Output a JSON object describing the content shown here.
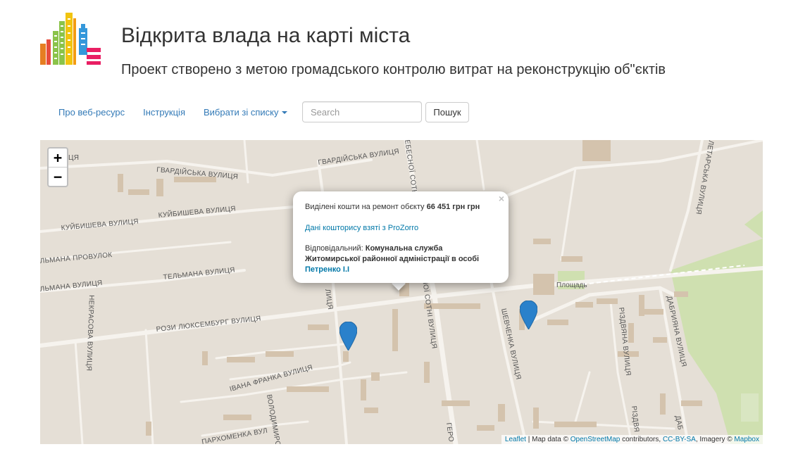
{
  "header": {
    "title": "Відкрита влада на карті міста",
    "subtitle": "Проект створено з метою громадського контролю витрат на реконструкцію об\"єктів"
  },
  "nav": {
    "items": [
      {
        "label": "Про веб-ресурс"
      },
      {
        "label": "Інструкція"
      },
      {
        "label": "Вибрати зі списку"
      }
    ]
  },
  "search": {
    "placeholder": "Search",
    "value": "",
    "button_label": "Пошук"
  },
  "map": {
    "zoom_in": "+",
    "zoom_out": "−",
    "street_labels": {
      "gvardiiska_1": "ГВАРДІЙСЬКА ВУЛИЦЯ",
      "gvardiiska_2": "ГВАРДІЙСЬКА ВУЛИЦЯ",
      "gvardiiska_frag": "ЦЯ",
      "kuibysheva_1": "КУЙБИШЕВА ВУЛИЦЯ",
      "kuibysheva_2": "КУЙБИШЕВА ВУЛИЦЯ",
      "telmana_provulok": "ЛЬМАНА ПРОВУЛОК",
      "telmana_1": "ТЕЛЬМАНА ВУЛИЦЯ",
      "telmana_2": "ЛЬМАНА ВУЛИЦЯ",
      "nekrasova": "НЕКРАСОВА ВУЛИЦЯ",
      "rozy": "РОЗИ ЛЮКСЕМБУРГ ВУЛИЦЯ",
      "ivana_franka": "ІВАНА ФРАНКА ВУЛИЦЯ",
      "volodymyrska": "ВОЛОДИМИРСЬКА",
      "parkhomenka": "ПАРХОМЕНКА ВУЛ",
      "nebesnoi_top": "ЕБЕСНОЇ СОТН",
      "nebesnoi_bottom": "НОЇ СОТНІ ВУЛИЦЯ",
      "heroiv": "ГЕРО",
      "shevchenka": "ШЕВЧЕНКА ВУЛИЦЯ",
      "rizdviana": "РІЗДВЯНА ВУЛИЦЯ",
      "rizdviana_2": "РІЗДВЯ",
      "dabrovskoho": "ДАБРИЯНА ВУЛИЦЯ",
      "dabr_2": "ДАБ",
      "proletarska": "ЛЕТАРСЬКА ВУЛИЦЯ",
      "vulytsia_frag": "ЛИЦЯ",
      "ploshcha": "Площадь"
    },
    "popup": {
      "line1_text": "Виділені кошти на ремонт обєкту",
      "line1_amount": "66 451 грн грн",
      "line2_link": "Дані кошторису взяті з ProZorro",
      "line3_label": "Відповідальний:",
      "line3_org_1": "Комунальна служба",
      "line3_org_2": "Житомирської районної адміністрації в особі",
      "line3_person": "Петренко І.І",
      "close": "×"
    },
    "attribution": {
      "leaflet": "Leaflet",
      "sep1": " | Map data © ",
      "osm": "OpenStreetMap",
      "sep2": " contributors, ",
      "license": "CC-BY-SA",
      "sep3": ", Imagery © ",
      "mapbox": "Mapbox"
    },
    "colors": {
      "map_bg": "#e5dfd6",
      "road": "#f6f3ee",
      "building": "#d4c3ad",
      "park": "#cfe0b0",
      "marker": "#2a81cb"
    }
  },
  "logo": {
    "bar_colors": [
      "#e74c3c",
      "#f39c12",
      "#8bc34a",
      "#f1c40f",
      "#3498db",
      "#e91e63"
    ]
  }
}
